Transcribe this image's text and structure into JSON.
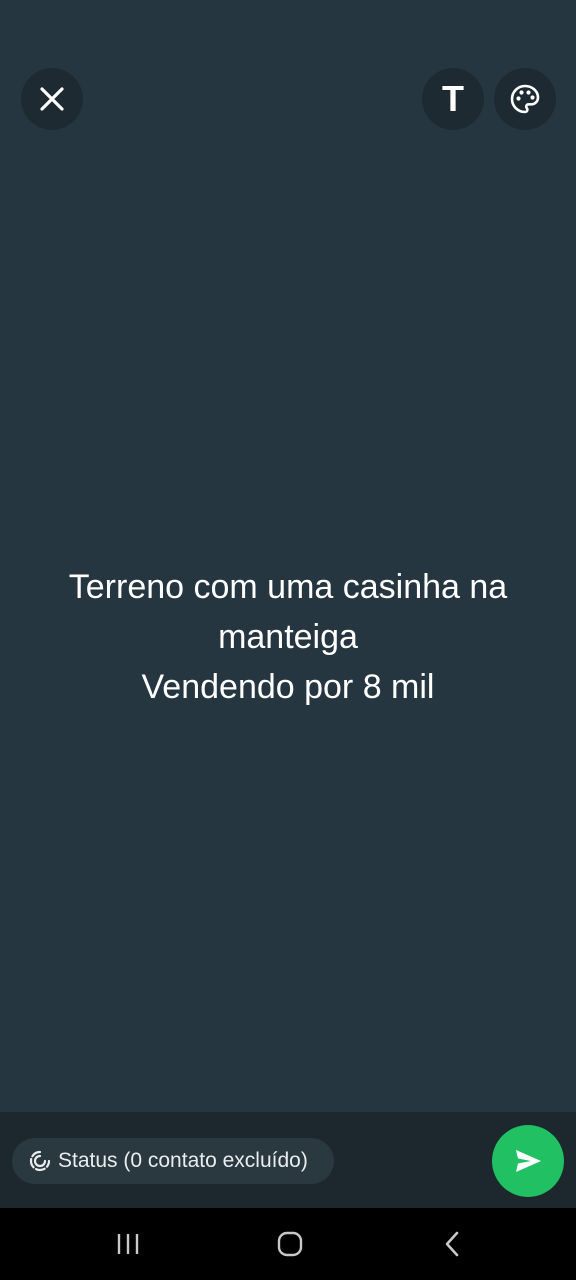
{
  "toolbar": {
    "text_tool_label": "T"
  },
  "status_text": {
    "lines": "Terreno com uma casinha na\nmanteiga\nVendendo por 8 mil"
  },
  "composer": {
    "audience_label": "Status (0 contato excluído)"
  },
  "icons": {
    "close": "close-icon",
    "text": "text-icon",
    "palette": "palette-icon",
    "audience": "status-ring-icon",
    "send": "send-icon",
    "recents": "recents-icon",
    "home": "home-icon",
    "back": "back-icon"
  },
  "colors": {
    "background": "#263640",
    "button_bg": "#1e2a31",
    "send_green": "#21c063",
    "text": "#ffffff"
  }
}
